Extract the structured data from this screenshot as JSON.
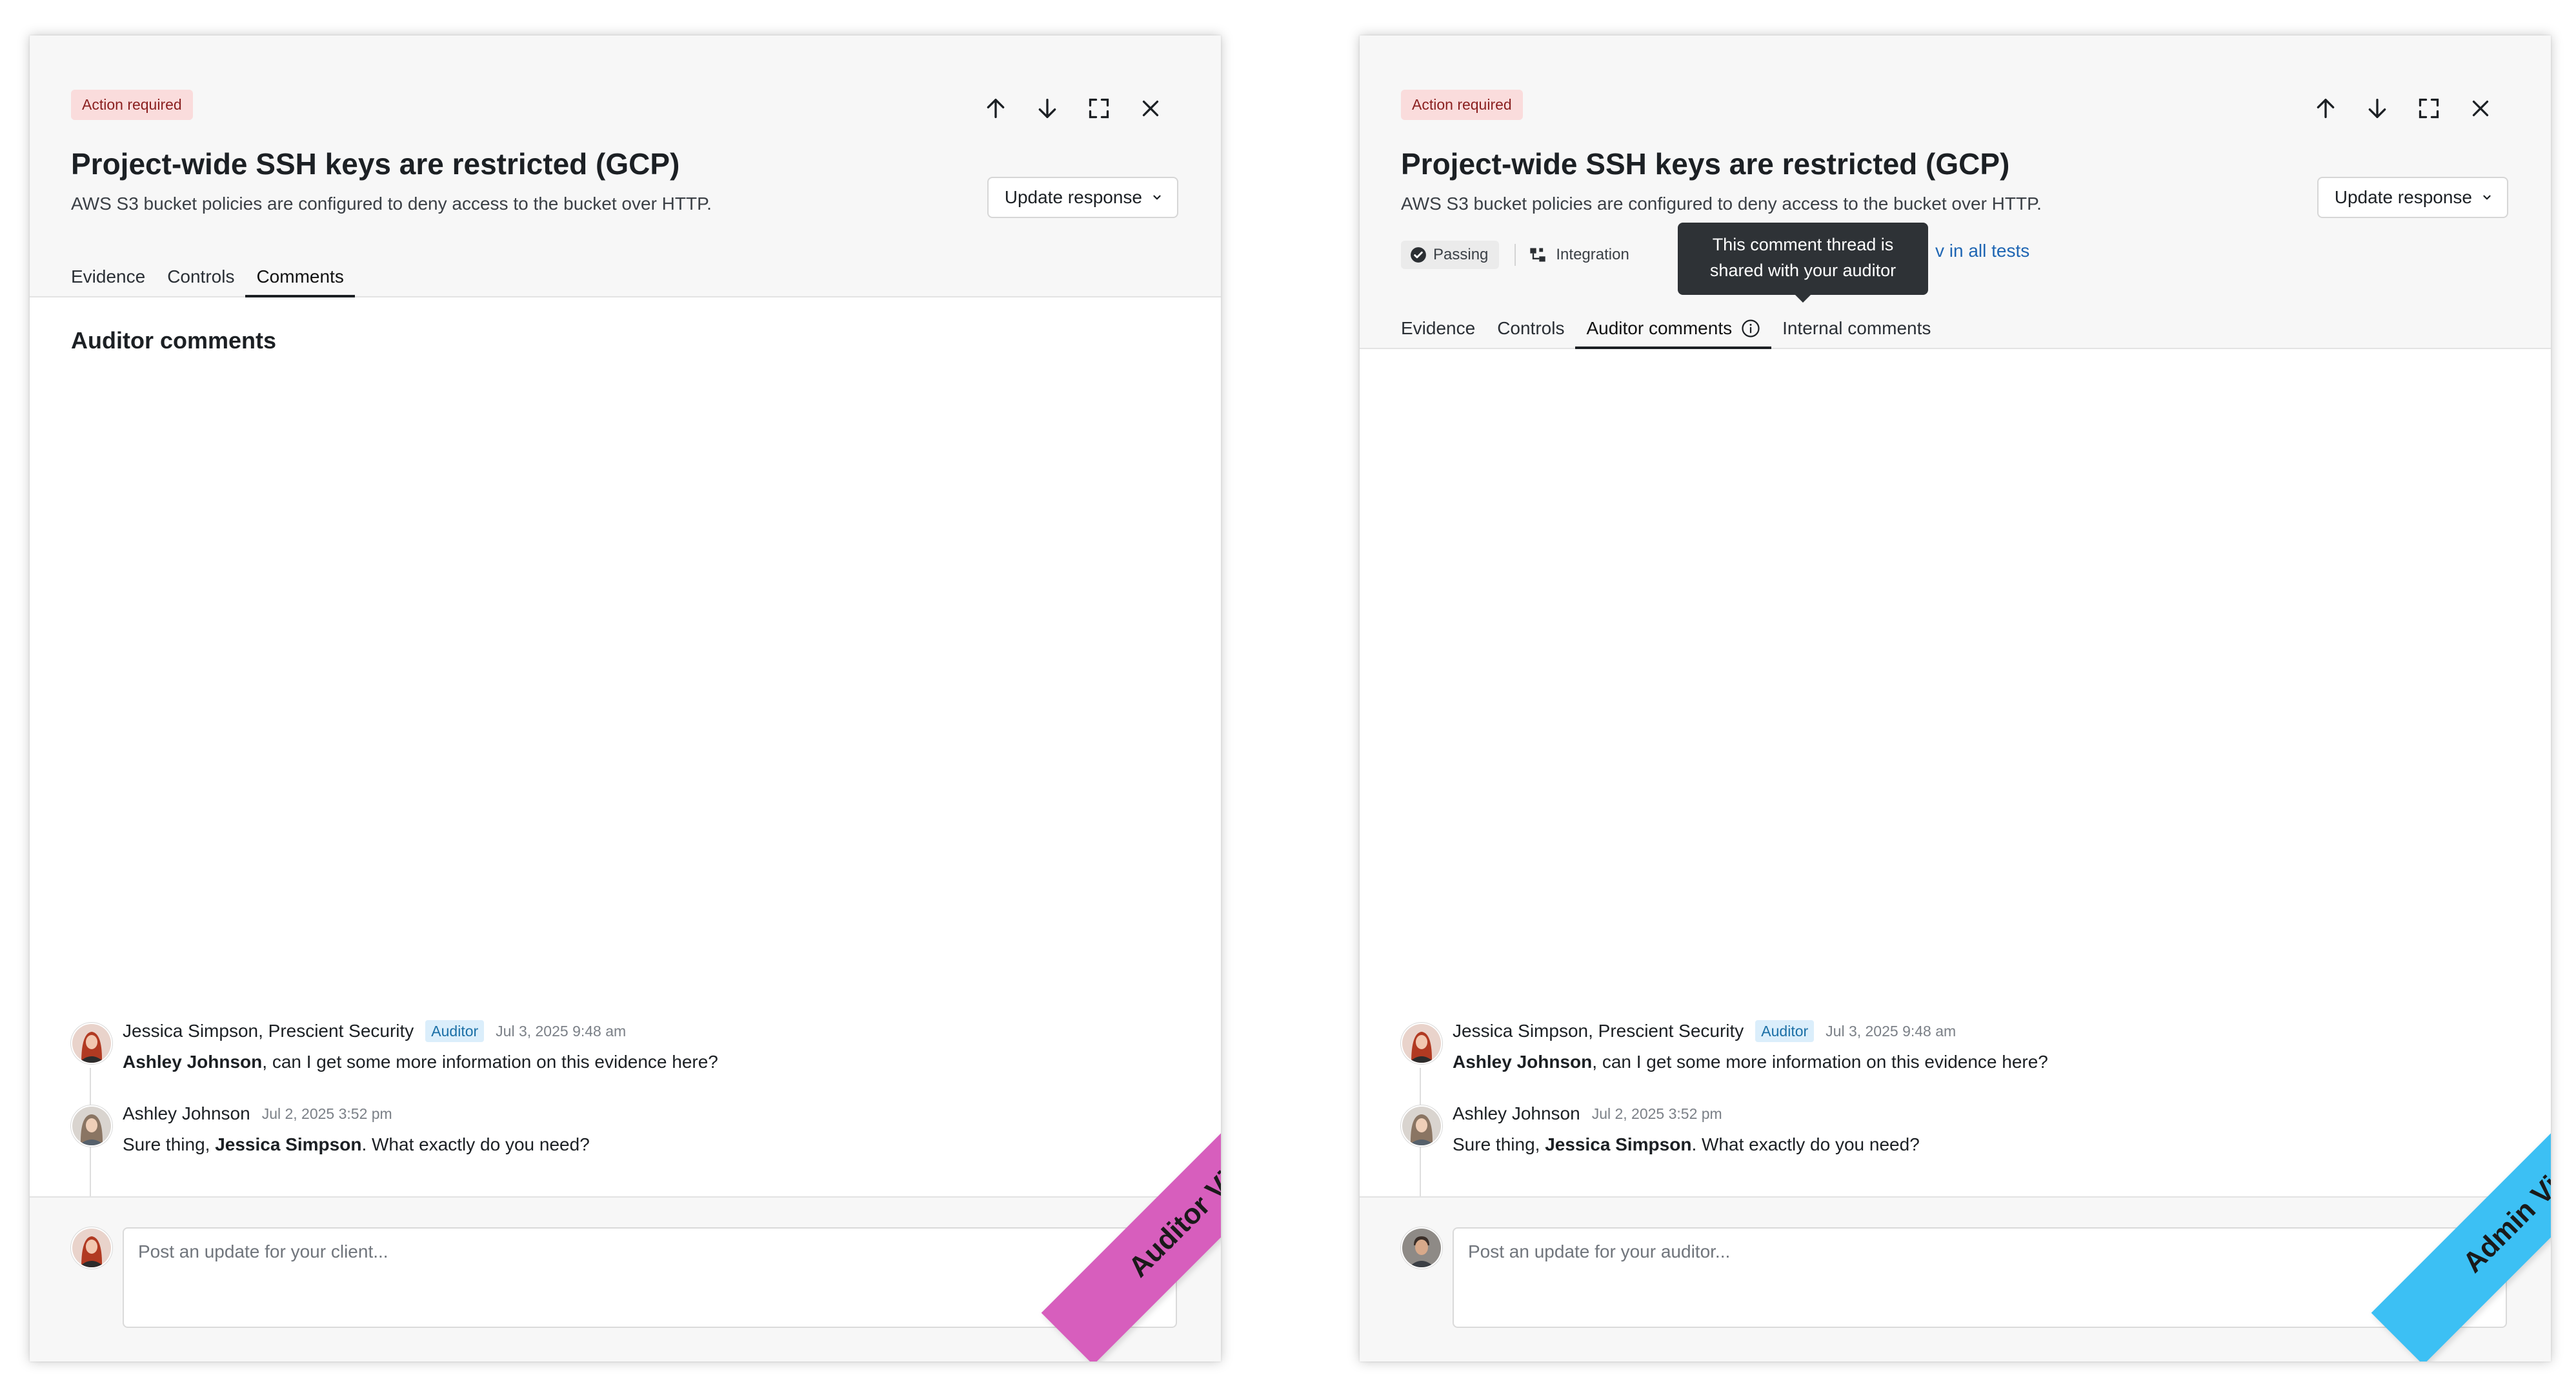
{
  "colors": {
    "auditor_ribbon": "#d75ebd",
    "admin_ribbon": "#3cc0f4",
    "action_badge_bg": "#fadcdc",
    "auditor_badge_bg": "#dbeefb",
    "link": "#1f66b3"
  },
  "icons": [
    "arrow-up-icon",
    "arrow-down-icon",
    "expand-icon",
    "close-icon",
    "chevron-down-icon",
    "check-circle-icon",
    "integration-icon",
    "info-icon"
  ],
  "auditor_view": {
    "badge": "Action required",
    "title": "Project-wide SSH keys are restricted (GCP)",
    "subtitle": "AWS S3 bucket policies are configured to deny access to the bucket over HTTP.",
    "update_button": "Update response",
    "tabs": [
      {
        "label": "Evidence"
      },
      {
        "label": "Controls"
      },
      {
        "label": "Comments"
      }
    ],
    "section_title": "Auditor comments",
    "comments": [
      {
        "author": "Jessica Simpson, Prescient Security",
        "role": "Auditor",
        "time": "Jul 3, 2025 9:48 am",
        "mention": "Ashley Johnson",
        "text_before": "",
        "text_after": ", can I get some more information on this evidence here?"
      },
      {
        "author": "Ashley Johnson",
        "time": "Jul 2, 2025 3:52 pm",
        "text_before": "Sure thing, ",
        "mention": "Jessica Simpson",
        "text_after": ". What exactly do you need?"
      }
    ],
    "composer_placeholder": "Post an update for your client...",
    "ribbon": "Auditor View"
  },
  "admin_view": {
    "badge": "Action required",
    "title": "Project-wide SSH keys are restricted (GCP)",
    "subtitle": "AWS S3 bucket policies are configured to deny access to the bucket over HTTP.",
    "update_button": "Update response",
    "status_chip": "Passing",
    "integration": "Integration",
    "tests_link": "v in all tests",
    "tooltip_line1": "This comment thread is",
    "tooltip_line2": "shared with your auditor",
    "tabs": [
      {
        "label": "Evidence"
      },
      {
        "label": "Controls"
      },
      {
        "label": "Auditor comments"
      },
      {
        "label": "Internal comments"
      }
    ],
    "comments": [
      {
        "author": "Jessica Simpson, Prescient Security",
        "role": "Auditor",
        "time": "Jul 3, 2025 9:48 am",
        "mention": "Ashley Johnson",
        "text_before": "",
        "text_after": ", can I get some more information on this evidence here?"
      },
      {
        "author": "Ashley Johnson",
        "time": "Jul 2, 2025 3:52 pm",
        "text_before": "Sure thing, ",
        "mention": "Jessica Simpson",
        "text_after": ". What exactly do you need?"
      }
    ],
    "composer_placeholder": "Post an update for your auditor...",
    "ribbon": "Admin View"
  }
}
